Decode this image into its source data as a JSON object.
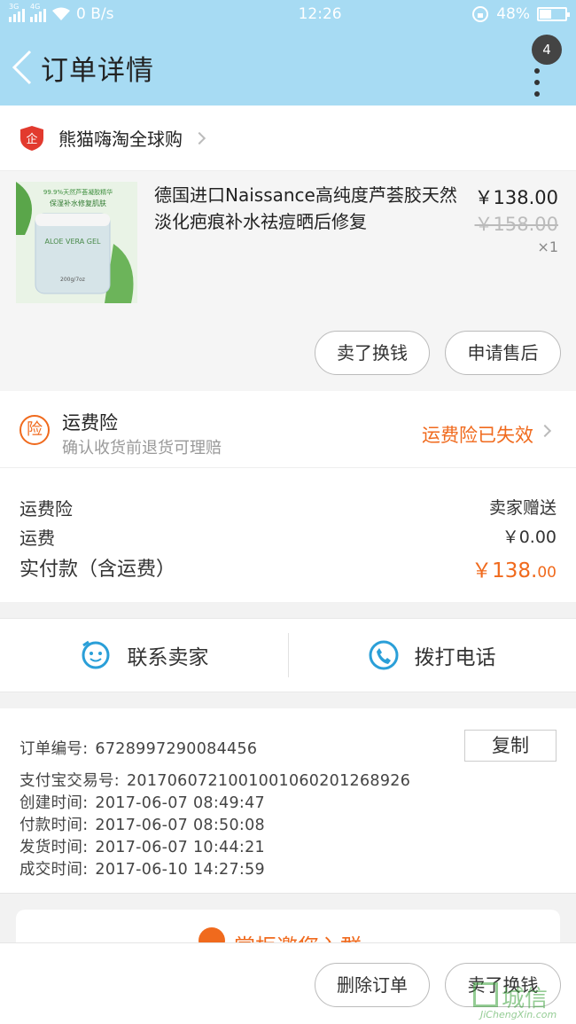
{
  "status_bar": {
    "net1": "3G",
    "net2": "4G",
    "speed": "0 B/s",
    "time": "12:26",
    "battery_level": "48%",
    "battery_fraction": 0.48
  },
  "header": {
    "title": "订单详情",
    "notification_count": "4"
  },
  "shop": {
    "name": "熊猫嗨淘全球购",
    "icon_label": "企"
  },
  "product": {
    "name": "德国进口Naissance高纯度芦荟胶天然淡化疤痕补水祛痘晒后修复",
    "price": "￥138.00",
    "original_price": "￥158.00",
    "quantity": "×1",
    "thumb_text_top": "99.9%天然芦荟凝胶精华",
    "thumb_text_mid": "保湿补水修复肌肤",
    "thumb_jar_label": "ALOE VERA GEL",
    "thumb_jar_weight": "200g/7oz",
    "buttons": {
      "sell_exchange": "卖了换钱",
      "after_sale": "申请售后"
    }
  },
  "insurance": {
    "icon_label": "险",
    "title": "运费险",
    "subtitle": "确认收货前退货可理赔",
    "status": "运费险已失效"
  },
  "fees": {
    "rows": [
      {
        "label": "运费险",
        "value": "卖家赠送"
      },
      {
        "label": "运费",
        "value": "￥0.00"
      }
    ],
    "paid_label": "实付款（含运费）",
    "paid_main": "￥138.",
    "paid_cents": "00"
  },
  "contact": {
    "seller": "联系卖家",
    "call": "拨打电话"
  },
  "order_info": {
    "copy_label": "复制",
    "rows": [
      {
        "label": "订单编号:",
        "value": "6728997290084456"
      },
      {
        "label": "支付宝交易号:",
        "value": "2017060721001001060201268926"
      },
      {
        "label": "创建时间:",
        "value": "2017-06-07 08:49:47"
      },
      {
        "label": "付款时间:",
        "value": "2017-06-07 08:50:08"
      },
      {
        "label": "发货时间:",
        "value": "2017-06-07 10:44:21"
      },
      {
        "label": "成交时间:",
        "value": "2017-06-10 14:27:59"
      }
    ]
  },
  "promo": {
    "text": "掌柜邀您入群"
  },
  "bottom": {
    "delete_order": "删除订单",
    "sell_exchange": "卖了换钱"
  },
  "watermark": {
    "cn": "城信",
    "en": "JiChengXin.com"
  },
  "colors": {
    "header_bg": "#a7dbf3",
    "accent_orange": "#f06a1d",
    "watermark_green": "#3ea33e"
  }
}
